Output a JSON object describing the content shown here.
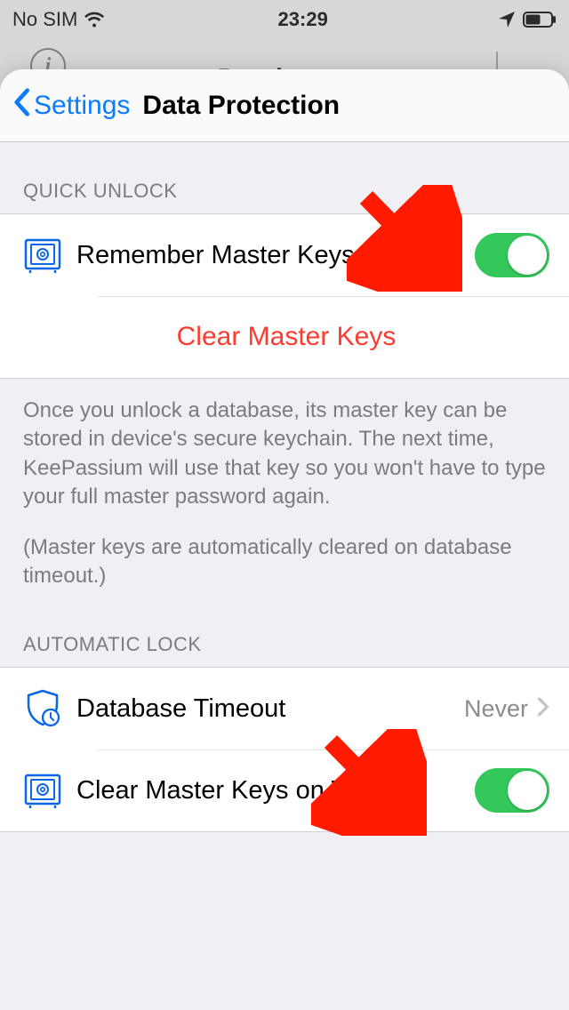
{
  "status": {
    "carrier": "No SIM",
    "time": "23:29"
  },
  "background": {
    "title": "Databases"
  },
  "nav": {
    "back": "Settings",
    "title": "Data Protection"
  },
  "sections": {
    "quick_unlock_header": "QUICK UNLOCK",
    "remember_label": "Remember Master Keys",
    "clear_button": "Clear Master Keys",
    "footer_p1": "Once you unlock a database, its master key can be stored in device's secure keychain. The next time, KeePassium will use that key so you won't have to type your full master password again.",
    "footer_p2": "(Master keys are automatically cleared on database timeout.)",
    "auto_lock_header": "AUTOMATIC LOCK",
    "db_timeout_label": "Database Timeout",
    "db_timeout_value": "Never",
    "clear_on_timeout_label": "Clear Master Keys on Timeout"
  }
}
